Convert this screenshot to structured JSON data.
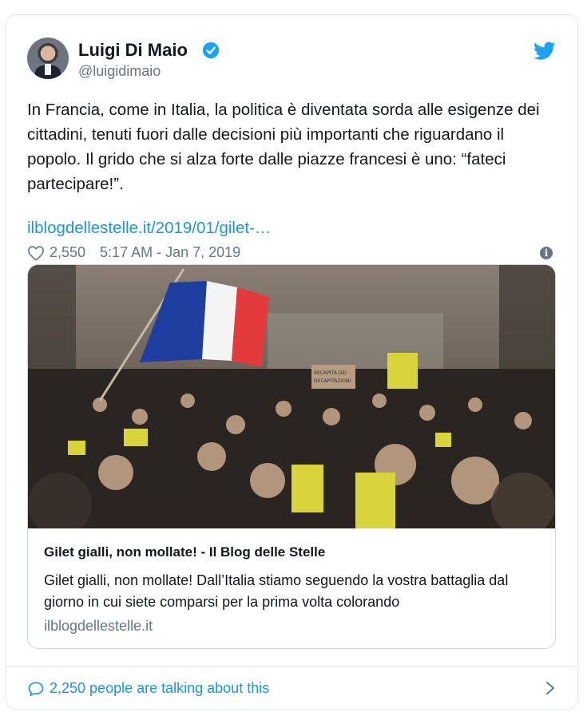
{
  "author": {
    "name": "Luigi Di Maio",
    "handle": "@luigidimaio"
  },
  "tweet": {
    "text": "In Francia, come in Italia, la politica è diventata sorda alle esigenze dei cittadini, tenuti fuori dalle decisioni più importanti che riguardano il popolo. Il grido che si alza forte dalle piazze francesi è uno: “fateci partecipare!”.",
    "link": "ilblogdellestelle.it/2019/01/gilet-…",
    "likes": "2,550",
    "timestamp": "5:17 AM - Jan 7, 2019"
  },
  "preview": {
    "photo_sign_1": "RECAPITA DEI",
    "photo_sign_2": "DECAPITAZIONI",
    "title": "Gilet gialli, non mollate! - Il Blog delle Stelle",
    "description": "Gilet gialli, non mollate! Dall’Italia stiamo seguendo la vostra battaglia dal giorno in cui siete comparsi per la prima volta colorando",
    "domain": "ilblogdellestelle.it"
  },
  "footer": {
    "talking": "2,250 people are talking about this"
  },
  "colors": {
    "link_blue": "#1b95e0",
    "muted_gray": "#657786",
    "verified_blue": "#1da1f2"
  },
  "icons": [
    "verified-badge-icon",
    "twitter-bird-icon",
    "heart-icon",
    "info-icon",
    "speech-bubble-icon",
    "chevron-right-icon"
  ]
}
